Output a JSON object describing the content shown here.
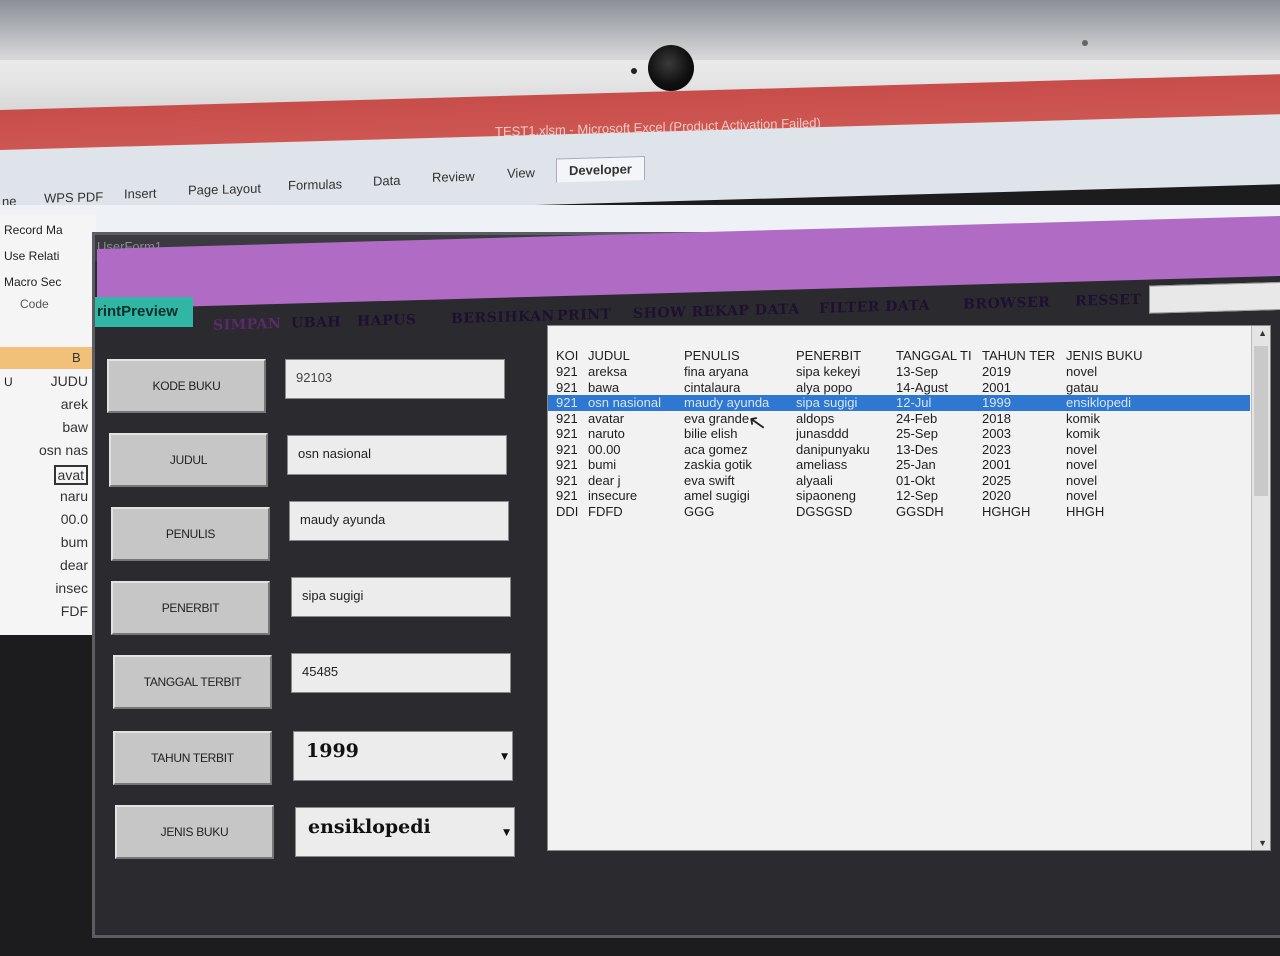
{
  "excel": {
    "window_title": "TEST1.xlsm - Microsoft Excel (Product Activation Failed)",
    "tabs": [
      "ne",
      "WPS PDF",
      "Insert",
      "Page Layout",
      "Formulas",
      "Data",
      "Review",
      "View",
      "Developer"
    ],
    "active_tab": "Developer",
    "ribbon_items": [
      "Record Ma",
      "Use Relati",
      "Macro Sec",
      "Code"
    ],
    "column_header": "B",
    "row_label": "U",
    "cells": [
      "JUDU",
      "arek",
      "baw",
      "osn nas",
      "avat",
      "naru",
      "00.0",
      "bum",
      "dear",
      "insec",
      "FDF"
    ]
  },
  "form": {
    "title": "UserForm1",
    "toolbar": {
      "printpreview": "rintPreview",
      "simpan": "SIMPAN",
      "ubah": "UBAH",
      "hapus": "HAPUS",
      "bersihkan": "BERSIHKAN",
      "print": "PRINT",
      "show_rekap": "SHOW REKAP DATA",
      "filter": "FILTER DATA",
      "browser": "BROWSER",
      "resset": "RESSET"
    },
    "fields": {
      "kode_buku_label": "KODE BUKU",
      "kode_buku_value": "92103",
      "judul_label": "JUDUL",
      "judul_value": "osn nasional",
      "penulis_label": "PENULIS",
      "penulis_value": "maudy ayunda",
      "penerbit_label": "PENERBIT",
      "penerbit_value": "sipa sugigi",
      "tanggal_label": "TANGGAL TERBIT",
      "tanggal_value": "45485",
      "tahun_label": "TAHUN TERBIT",
      "tahun_value": "1999",
      "jenis_label": "JENIS BUKU",
      "jenis_value": "ensiklopedi"
    },
    "list": {
      "headers": [
        "KOI",
        "JUDUL",
        "PENULIS",
        "PENERBIT",
        "TANGGAL TI",
        "TAHUN TER",
        "JENIS BUKU"
      ],
      "rows": [
        [
          "921",
          "areksa",
          "fina aryana",
          "sipa kekeyi",
          "13-Sep",
          "2019",
          "novel"
        ],
        [
          "921",
          "bawa",
          "cintalaura",
          "alya popo",
          "14-Agust",
          "2001",
          "gatau"
        ],
        [
          "921",
          "osn nasional",
          "maudy ayunda",
          "sipa sugigi",
          "12-Jul",
          "1999",
          "ensiklopedi"
        ],
        [
          "921",
          "avatar",
          "eva grande",
          "aldops",
          "24-Feb",
          "2018",
          "komik"
        ],
        [
          "921",
          "naruto",
          "bilie elish",
          "junasddd",
          "25-Sep",
          "2003",
          "komik"
        ],
        [
          "921",
          "00.00",
          "aca gomez",
          "danipunyaku",
          "13-Des",
          "2023",
          "novel"
        ],
        [
          "921",
          "bumi",
          "zaskia gotik",
          "ameliass",
          "25-Jan",
          "2001",
          "novel"
        ],
        [
          "921",
          "dear j",
          "eva swift",
          "alyaali",
          "01-Okt",
          "2025",
          "novel"
        ],
        [
          "921",
          "insecure",
          "amel sugigi",
          "sipaoneng",
          "12-Sep",
          "2020",
          "novel"
        ],
        [
          "DDI",
          "FDFD",
          "GGG",
          "DGSGSD",
          "GGSDH",
          "HGHGH",
          "HHGH"
        ]
      ],
      "selected_index": 2
    }
  }
}
